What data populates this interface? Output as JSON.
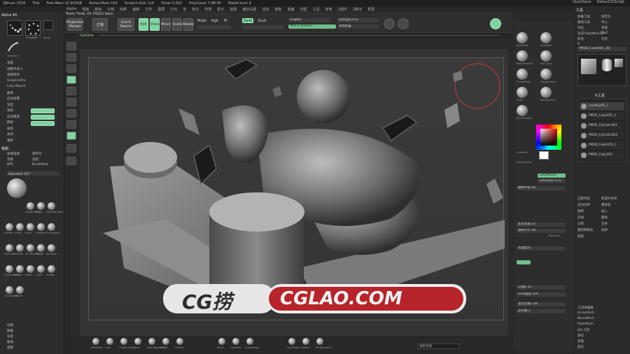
{
  "topbar": {
    "app": "ZBrush 2018",
    "items": [
      "Trial",
      "Free Mem 22.943GB",
      "Active Mem 554",
      "Scratch Disk 116",
      "Timer 0.001",
      "PolyCount 7.88 KP",
      "MeshCount 4"
    ],
    "right": [
      "QuickSave",
      "Default2ZScript"
    ]
  },
  "menus": [
    "Alpha",
    "笔刷",
    "颜色",
    "文档",
    "绘制",
    "编辑",
    "文件",
    "图层",
    "灯光",
    "宏",
    "标记",
    "材质",
    "影片",
    "拾取",
    "偏好设置",
    "渲染",
    "模板",
    "笔触",
    "纹理",
    "工具",
    "变换",
    "Z插件",
    "Z脚本",
    "帮助"
  ],
  "toolbar": {
    "track_time": "Track Time: 22.74222 Secs",
    "projection_label": "Projection Master",
    "lightbox_label": "灯箱",
    "quicksketch_label": "Quick Sketch",
    "edit_label": "Edit",
    "draw_label": "Draw",
    "move_label": "Move",
    "scale_label": "Scale",
    "rotate_label": "Rotate",
    "mrgb": "Mrgb",
    "rgb": "Rgb",
    "m": "M",
    "zadd": "Zadd",
    "zsub": "Zsub",
    "english": "English",
    "chinese": "中文 (Chinese)",
    "custom_ui": "启用自定义UI",
    "default_ui": "初始配置"
  },
  "timeline": {
    "label": "Camera"
  },
  "left_panel": {
    "alpha_title": "Alpha 44",
    "brush_label": "Standard",
    "stroke_label": "DragRect",
    "spray_label": "Spray",
    "brush_title": "笔刷",
    "settings": [
      "笔刷",
      "调整平滑 4",
      "笔刷修改",
      "SculptrisPro",
      "Lazy Mouse",
      "曲线",
      "自动遮罩",
      "深度",
      "采样",
      "前后精度",
      "网格",
      "画笔",
      "关闭",
      "重新"
    ],
    "tool_section": "笔刷",
    "tool_items": [
      "加载笔刷",
      "保存为",
      "克隆",
      "选项",
      "BPR",
      "BrushMod",
      "Standard 127"
    ],
    "brush_names": [
      "Standard",
      "Clay",
      "ClayBuildup",
      "Move",
      "DamStandard",
      "hPolish",
      "Inflat",
      "Pinch",
      "Smooth",
      "Snakehook",
      "Dam Std",
      "Flatten",
      "TrimDynamic",
      "Planar",
      "SK Slash",
      "ClayTubes",
      "Mallet",
      "Polish",
      "Layer",
      "Nudge",
      "CurveTube",
      "Morph"
    ],
    "bottom_items": [
      "创建",
      "数据",
      "深度",
      "曲线",
      "建模"
    ]
  },
  "right_tools": {
    "labels": [
      "Standard",
      "DragRect",
      "BasicMaterial",
      "Flat Color",
      "SnakeHook",
      "ClayBuildup",
      "Inflat",
      "MatCap Red",
      "SkinShade4"
    ],
    "gradient_label": "Gradient",
    "switch_color": "SwitchColor",
    "alternate": "Alternate",
    "lazy_mouse": "LazyMouse",
    "lazy_step": "LazyStep 0.25",
    "lazy_radius": "懒惰半径 44",
    "dynamic": "Dynamic",
    "double": "双面显示",
    "focal_shift": "焦点衰减 25",
    "draw_size": "绘制大小 44",
    "zintensity": "Z强度 25",
    "rgb_intensity": "RGB强度 100",
    "active_points": "激活点数 128",
    "total_points": "总点数 1"
  },
  "right_panel": {
    "title": "工具",
    "top_items": [
      "加载工具",
      "另存为",
      "复制工具",
      "导入",
      "导出",
      "克隆",
      "生成 PolyMesh3D",
      "GoZ",
      "所有",
      "可见",
      "R"
    ],
    "tool_name": "PM3D_Cube3D1_48",
    "tool_thumbs": [
      "PM3D_Cube3D1",
      "Cylinder3D",
      "SimpleBrush",
      "PM3D_Cube3D1"
    ],
    "subtool_title": "子工具",
    "subtools": [
      "LowPoly60_1",
      "PM3D_Cube3D1_1",
      "PM3D_Cylinder3D1",
      "PM3D_Cylinder3D2",
      "PM3D_Cube3D1_1",
      "PM3D_Cube3D1"
    ],
    "bottom_items": [
      "全部列出",
      "新建文件夹",
      "自动合并",
      "重命名",
      "复制",
      "插入",
      "追加",
      "删除",
      "分割",
      "合并",
      "重新网格化",
      "投射",
      "提取"
    ],
    "lower_items": [
      "几何体编辑",
      "ArrayMesh",
      "NanoMesh",
      "FiberMesh",
      "HD 几何",
      "预览",
      "表面",
      "变形"
    ]
  },
  "bottom_bar": {
    "labels": [
      "Standard",
      "Clay",
      "ClayBuildup",
      "Move",
      "DamStandard",
      "Inflat",
      "hPolish",
      "Pinch",
      "Smooth",
      "SnakeHook",
      "ClayTubes",
      "Flatten",
      "TrimDynamic"
    ],
    "search_placeholder": "搜索笔刷"
  },
  "watermark": {
    "text1": "CG捞",
    "text2": "CGLAO.COM"
  }
}
